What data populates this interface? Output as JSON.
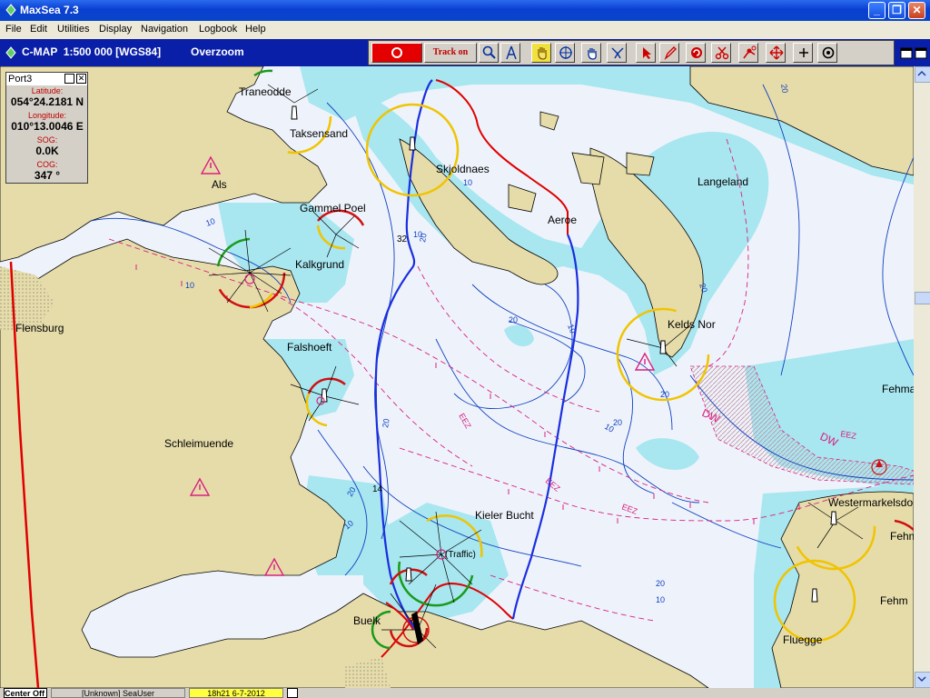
{
  "window": {
    "title": "MaxSea 7.3",
    "minimize": "_",
    "restore": "❐",
    "close": "✕"
  },
  "menu": {
    "items": [
      "File",
      "Edit",
      "Utilities",
      "Display",
      "Navigation",
      "Logbook",
      "Help"
    ]
  },
  "chart": {
    "title": "C-MAP  1:500 000 [WGS84]",
    "zoom_state": "Overzoom"
  },
  "toolbar": {
    "track_label": "Track on",
    "tools": [
      "search-icon",
      "compass-icon",
      "pan-hand-icon",
      "crosshair-icon",
      "drag-hand-icon",
      "route-icon",
      "pointer-icon",
      "pencil-icon",
      "erase-icon",
      "cut-icon",
      "edit-route-icon",
      "move-icon",
      "plus-icon",
      "target-icon"
    ]
  },
  "info_panel": {
    "title": "Port3",
    "fields": [
      {
        "label": "Latitude:",
        "value": "054°24.2181 N"
      },
      {
        "label": "Longitude:",
        "value": "010°13.0046 E"
      },
      {
        "label": "SOG:",
        "value": "0.0K"
      },
      {
        "label": "COG:",
        "value": "347 °"
      }
    ]
  },
  "map": {
    "places": [
      "Traneodde",
      "Taksensand",
      "Als",
      "Gammel Poel",
      "Kalkgrund",
      "Flensburg",
      "Falshoeft",
      "Schleimuende",
      "Skjoldnaes",
      "Aeroe",
      "Langeland",
      "Kelds Nor",
      "Kieler Bucht",
      "Buelk",
      "Westermarkelsdorf",
      "Fehmarn",
      "Fluegge",
      "Fehm",
      "Fehma"
    ],
    "traffic_label": "(Traffic)",
    "depth_labels": [
      "10",
      "10",
      "10",
      "10",
      "10",
      "10",
      "10",
      "10",
      "20",
      "20",
      "20",
      "20",
      "20",
      "20",
      "20",
      "20",
      "20",
      "32",
      "14"
    ],
    "zone_labels": [
      "EEZ",
      "EEZ",
      "EEZ",
      "EEZ",
      "DW",
      "DW"
    ],
    "colors": {
      "land": "#e6dcaa",
      "shallow": "#a8e6f0",
      "deep": "#eef3fb",
      "contour": "#1040c0",
      "track": "#1a2ee0",
      "route": "#e00000",
      "zone": "#d82080",
      "sector_yellow": "#f0c400",
      "sector_red": "#d01010",
      "sector_green": "#1a9a1a"
    }
  },
  "status": {
    "center": "Center Off",
    "user": "[Unknown] SeaUser",
    "datetime": "18h21 6-7-2012"
  }
}
